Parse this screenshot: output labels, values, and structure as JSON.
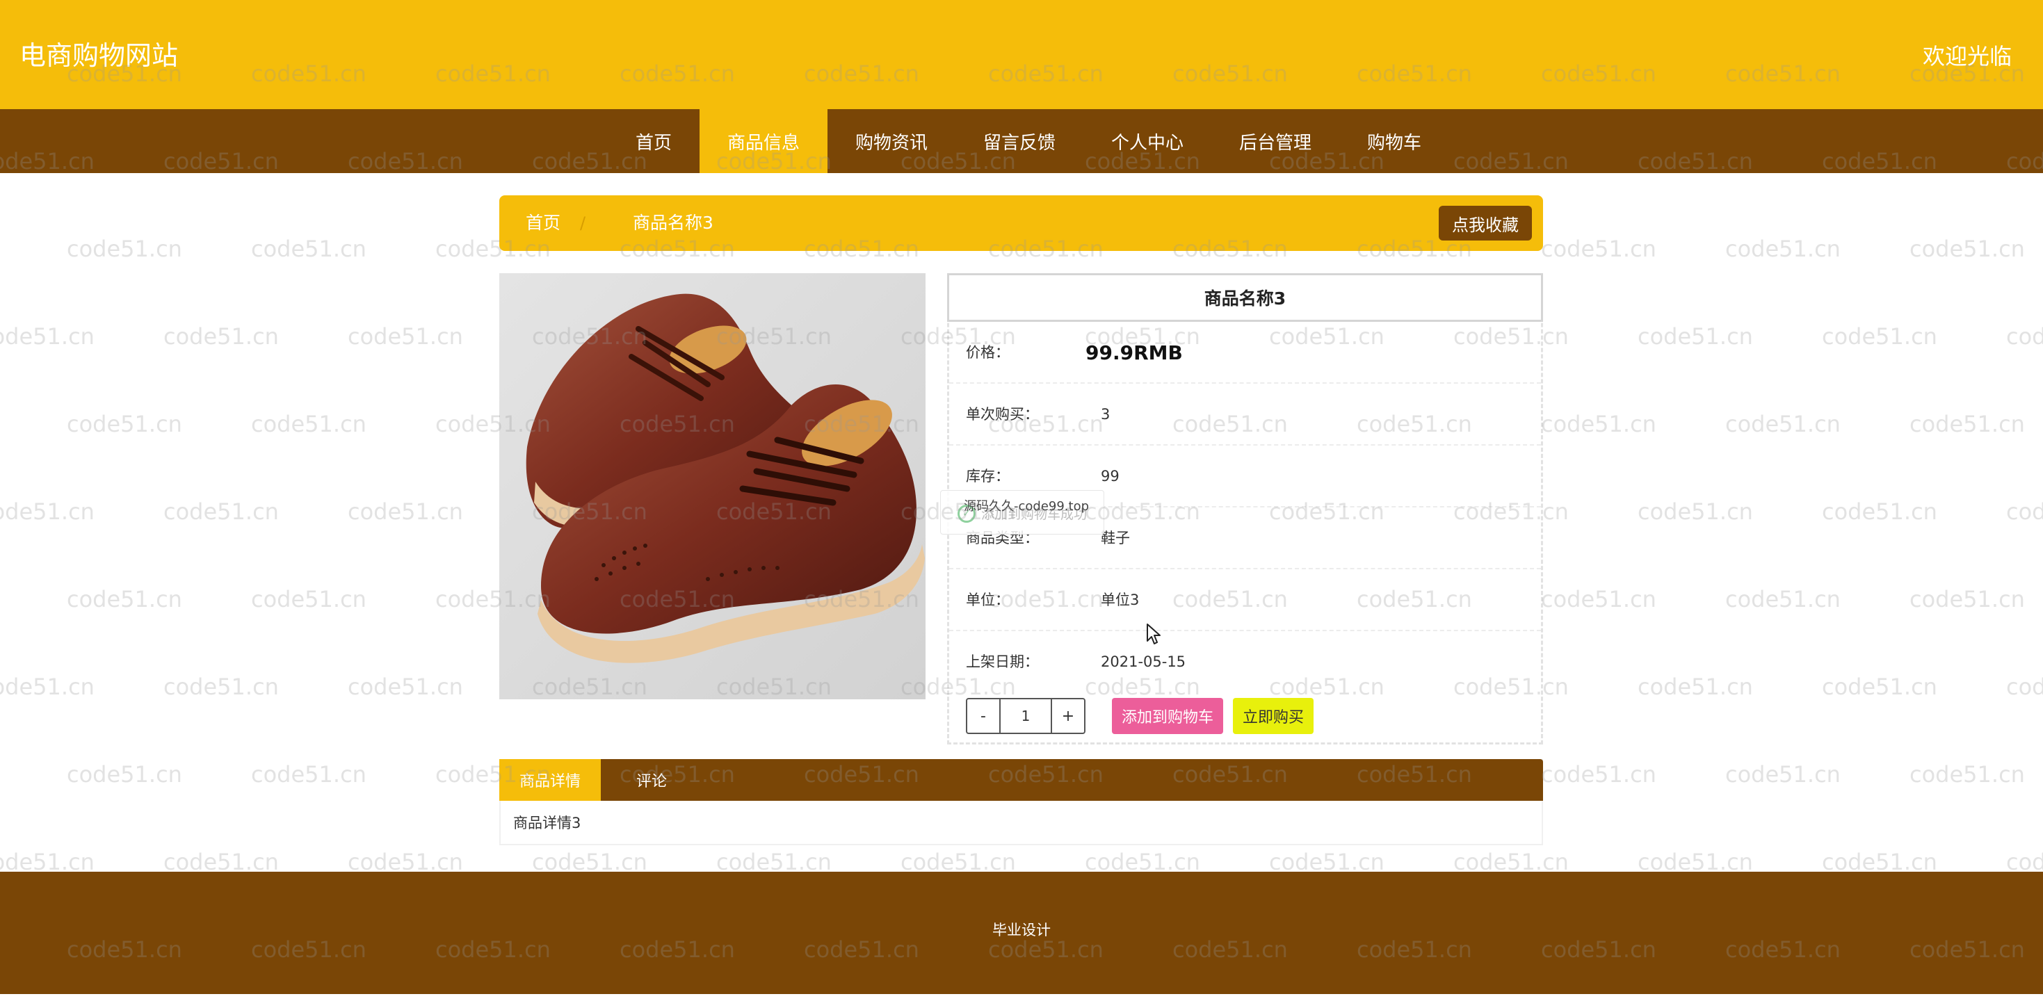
{
  "header": {
    "site_title": "电商购物网站",
    "welcome": "欢迎光临"
  },
  "nav": {
    "items": [
      {
        "label": "首页",
        "active": false
      },
      {
        "label": "商品信息",
        "active": true
      },
      {
        "label": "购物资讯",
        "active": false
      },
      {
        "label": "留言反馈",
        "active": false
      },
      {
        "label": "个人中心",
        "active": false
      },
      {
        "label": "后台管理",
        "active": false
      },
      {
        "label": "购物车",
        "active": false
      }
    ]
  },
  "breadcrumb": {
    "home": "首页",
    "separator": "/",
    "current": "商品名称3",
    "favorite_button": "点我收藏"
  },
  "product": {
    "image_alt": "brown leather brogue shoes",
    "name": "商品名称3",
    "price_label": "价格：",
    "price_value": "99.9RMB",
    "single_buy_label": "单次购买：",
    "single_buy_value": "3",
    "stock_label": "库存：",
    "stock_value": "99",
    "type_label": "商品类型：",
    "type_value": "鞋子",
    "unit_label": "单位：",
    "unit_value": "单位3",
    "date_label": "上架日期：",
    "date_value": "2021-05-15",
    "quantity": {
      "minus": "-",
      "value": "1",
      "plus": "+"
    },
    "add_to_cart_button": "添加到购物车",
    "buy_now_button": "立即购买"
  },
  "toast": {
    "message": "添加到购物车成功",
    "overlay_text": "源码久久-code99.top"
  },
  "tabs": {
    "items": [
      {
        "label": "商品详情",
        "active": true
      },
      {
        "label": "评论",
        "active": false
      }
    ],
    "content": "商品详情3"
  },
  "footer": {
    "text": "毕业设计"
  },
  "watermark": {
    "text": "code51.cn"
  },
  "colors": {
    "primary_yellow": "#f5bd0a",
    "primary_brown": "#7a4606",
    "cart_pink": "#ec5e9a",
    "buy_yellow": "#e8f00c"
  }
}
